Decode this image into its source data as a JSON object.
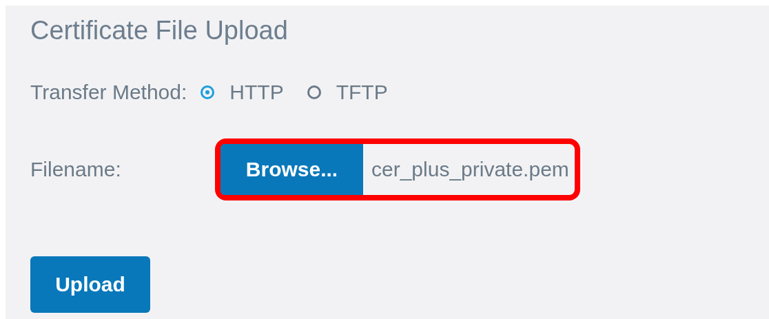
{
  "title": "Certificate File Upload",
  "transfer_method": {
    "label": "Transfer Method:",
    "options": [
      {
        "label": "HTTP",
        "selected": true
      },
      {
        "label": "TFTP",
        "selected": false
      }
    ]
  },
  "filename": {
    "label": "Filename:",
    "button": "Browse...",
    "value": "cer_plus_private.pem",
    "highlighted": true
  },
  "buttons": [
    "Upload"
  ]
}
